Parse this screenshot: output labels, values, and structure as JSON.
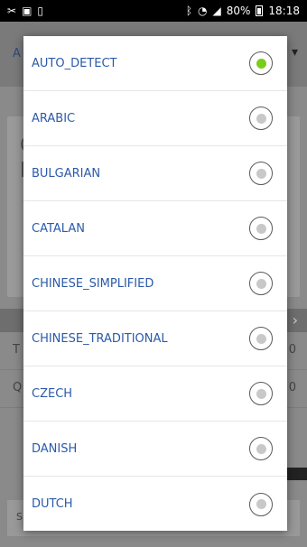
{
  "status_bar": {
    "left_icons": [
      "scissors-icon",
      "sim-icon",
      "clipboard-icon"
    ],
    "battery_percent": "80%",
    "time": "18:18"
  },
  "background_app": {
    "toolbar_left": "A",
    "toolbar_right": "▾",
    "card_letters": [
      "C",
      "b"
    ],
    "rows": [
      {
        "left": "T",
        "right": "0"
      },
      {
        "left": "Q",
        "right": "0"
      }
    ],
    "bottom_text": "S"
  },
  "dialog": {
    "options": [
      {
        "label": "AUTO_DETECT",
        "selected": true
      },
      {
        "label": "ARABIC",
        "selected": false
      },
      {
        "label": "BULGARIAN",
        "selected": false
      },
      {
        "label": "CATALAN",
        "selected": false
      },
      {
        "label": "CHINESE_SIMPLIFIED",
        "selected": false
      },
      {
        "label": "CHINESE_TRADITIONAL",
        "selected": false
      },
      {
        "label": "CZECH",
        "selected": false
      },
      {
        "label": "DANISH",
        "selected": false
      },
      {
        "label": "DUTCH",
        "selected": false
      }
    ]
  },
  "colors": {
    "option_text": "#2b5aa8",
    "radio_selected": "#7ccc1c",
    "radio_unselected": "#c8c8c8"
  }
}
